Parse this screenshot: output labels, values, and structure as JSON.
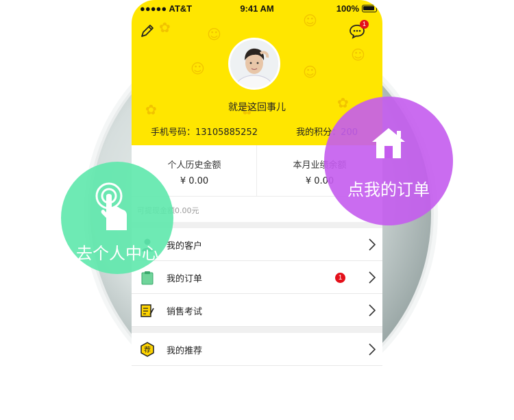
{
  "status_bar": {
    "carrier": "●●●●● AT&T",
    "time": "9:41 AM",
    "battery": "100%"
  },
  "header": {
    "message_badge": "1"
  },
  "profile": {
    "username": "就是这回事儿",
    "phone_label": "手机号码：",
    "phone": "13105885252",
    "points_label": "我的积分：",
    "points": "200"
  },
  "stats": [
    {
      "label": "个人历史金额",
      "value": "¥ 0.00"
    },
    {
      "label": "本月业绩余额",
      "value": "¥ 0.00"
    }
  ],
  "withdrawable": "可提现金额0.00元",
  "menu": [
    {
      "label": "我的客户",
      "icon": "customer-icon"
    },
    {
      "label": "我的订单",
      "icon": "order-icon",
      "badge": "1"
    },
    {
      "label": "销售考试",
      "icon": "exam-icon"
    },
    {
      "label": "我的推荐",
      "icon": "recommend-icon"
    }
  ],
  "callouts": {
    "orders": "点我的订单",
    "personal": "去个人中心"
  },
  "colors": {
    "header": "#ffe600",
    "purple": "#c45cee",
    "green": "#5ee8ac",
    "badge": "#e4101a"
  }
}
